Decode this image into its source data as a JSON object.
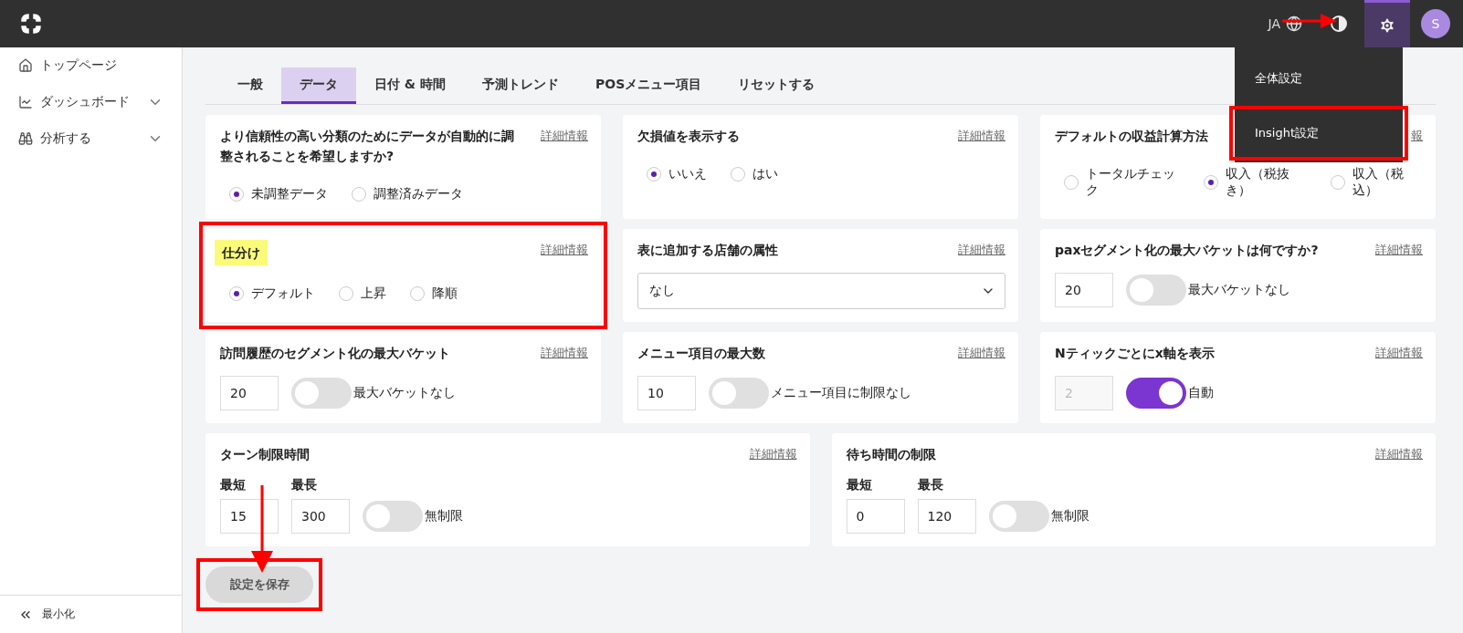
{
  "topbar": {
    "language": "JA",
    "avatar": "S",
    "settings_active": true
  },
  "menu": {
    "items": [
      {
        "label": "全体設定",
        "annotated": false
      },
      {
        "label": "Insight設定",
        "annotated": true
      }
    ]
  },
  "sidebar": {
    "items": [
      {
        "label": "トップページ",
        "expandable": false
      },
      {
        "label": "ダッシュボード",
        "expandable": true
      },
      {
        "label": "分析する",
        "expandable": true
      }
    ],
    "collapse": "最小化"
  },
  "tabs": [
    {
      "label": "一般",
      "selected": false
    },
    {
      "label": "データ",
      "selected": true
    },
    {
      "label": "日付 & 時間",
      "selected": false
    },
    {
      "label": "予測トレンド",
      "selected": false
    },
    {
      "label": "POSメニュー項目",
      "selected": false
    },
    {
      "label": "リセットする",
      "selected": false
    }
  ],
  "rows": [
    [
      {
        "kind": "radio",
        "title": "より信頼性の高い分類のためにデータが自動的に調整されることを希望しますか?",
        "link": "詳細情報",
        "highlighted": false,
        "annotated": false,
        "options": [
          {
            "label": "未調整データ",
            "selected": true
          },
          {
            "label": "調整済みデータ",
            "selected": false
          }
        ]
      },
      {
        "kind": "radio",
        "title": "欠損値を表示する",
        "link": "詳細情報",
        "highlighted": false,
        "annotated": false,
        "options": [
          {
            "label": "いいえ",
            "selected": true
          },
          {
            "label": "はい",
            "selected": false
          }
        ]
      },
      {
        "kind": "radio",
        "title": "デフォルトの収益計算方法",
        "link": "報",
        "highlighted": false,
        "annotated": false,
        "options": [
          {
            "label": "トータルチェック",
            "selected": false
          },
          {
            "label": "収入（税抜き）",
            "selected": true
          },
          {
            "label": "収入（税込）",
            "selected": false
          }
        ]
      }
    ],
    [
      {
        "kind": "radio",
        "title": "仕分け",
        "link": "詳細情報",
        "highlighted": true,
        "annotated": true,
        "options": [
          {
            "label": "デフォルト",
            "selected": true
          },
          {
            "label": "上昇",
            "selected": false
          },
          {
            "label": "降順",
            "selected": false
          }
        ]
      },
      {
        "kind": "select",
        "title": "表に追加する店舗の属性",
        "link": "詳細情報",
        "highlighted": false,
        "annotated": false,
        "value": "なし"
      },
      {
        "kind": "number_toggle",
        "title": "paxセグメント化の最大バケットは何ですか?",
        "link": "詳細情報",
        "highlighted": false,
        "annotated": false,
        "value": "20",
        "disabled": false,
        "toggle": {
          "on": false,
          "label": "最大バケットなし"
        }
      }
    ],
    [
      {
        "kind": "number_toggle",
        "title": "訪問履歴のセグメント化の最大バケット",
        "link": "詳細情報",
        "highlighted": false,
        "annotated": false,
        "value": "20",
        "disabled": false,
        "toggle": {
          "on": false,
          "label": "最大バケットなし"
        }
      },
      {
        "kind": "number_toggle",
        "title": "メニュー項目の最大数",
        "link": "詳細情報",
        "highlighted": false,
        "annotated": false,
        "value": "10",
        "disabled": false,
        "toggle": {
          "on": false,
          "label": "メニュー項目に制限なし"
        }
      },
      {
        "kind": "number_toggle",
        "title": "Nティックごとにx軸を表示",
        "link": "詳細情報",
        "highlighted": false,
        "annotated": false,
        "value": "2",
        "disabled": true,
        "toggle": {
          "on": true,
          "label": "自動"
        }
      }
    ],
    [
      {
        "kind": "range_toggle",
        "title": "ターン制限時間",
        "link": "詳細情報",
        "highlighted": false,
        "annotated": false,
        "min_label": "最短",
        "min_value": "15",
        "max_label": "最長",
        "max_value": "300",
        "toggle": {
          "on": false,
          "label": "無制限"
        }
      },
      {
        "kind": "range_toggle",
        "title": "待ち時間の制限",
        "link": "詳細情報",
        "highlighted": false,
        "annotated": false,
        "min_label": "最短",
        "min_value": "0",
        "max_label": "最長",
        "max_value": "120",
        "toggle": {
          "on": false,
          "label": "無制限"
        }
      }
    ]
  ],
  "save_button": {
    "label": "設定を保存",
    "annotated": true
  }
}
